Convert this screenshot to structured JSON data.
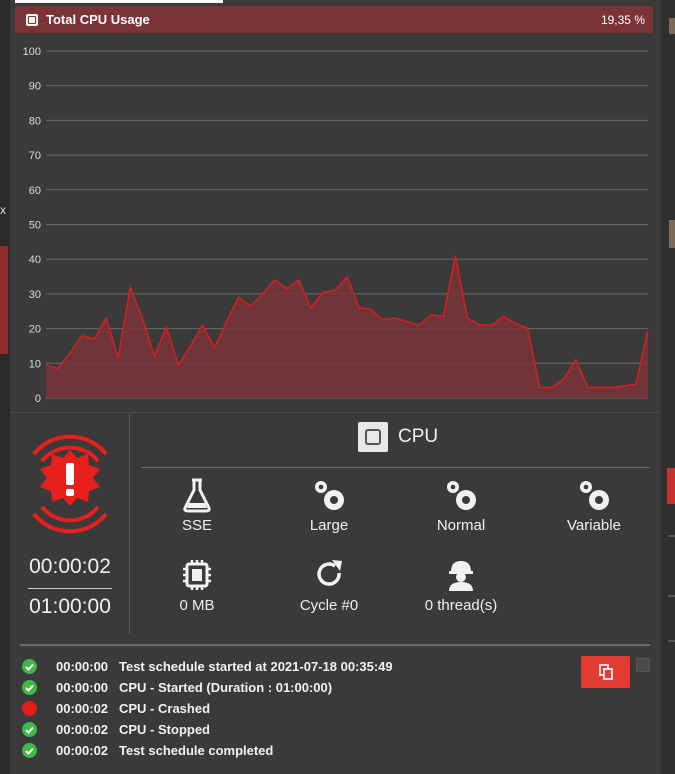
{
  "chart_header": {
    "title": "Total CPU Usage",
    "value": "19,35 %",
    "header_color": "#7a3337"
  },
  "chart_data": {
    "type": "area",
    "ylim": [
      0,
      100
    ],
    "y_ticks": [
      "100",
      "90",
      "80",
      "70",
      "60",
      "50",
      "40",
      "30",
      "20",
      "10",
      "0"
    ],
    "grid": true,
    "line_color": "#d02020",
    "fill_color": "#7a3337",
    "series": [
      {
        "values": [
          9.5,
          8.5,
          13,
          18,
          17,
          23,
          11.5,
          32,
          23,
          12,
          20.5,
          9.5,
          15,
          21,
          14.5,
          22,
          29,
          26.5,
          30,
          34,
          31.5,
          34,
          26,
          30.5,
          31,
          35,
          26,
          25.5,
          22.5,
          23,
          22,
          21,
          24,
          23.5,
          41,
          23,
          21,
          21,
          23.5,
          21.5,
          20,
          3,
          3,
          5.5,
          11,
          3,
          3,
          3,
          3.5,
          4,
          19.5
        ]
      }
    ]
  },
  "status": {
    "alarm_icon": "alarm-exclamation-icon",
    "elapsed": "00:00:02",
    "duration": "01:00:00"
  },
  "device": {
    "icon": "cpu-chip-icon",
    "name": "CPU"
  },
  "stats": [
    {
      "icon": "flask-icon",
      "label": "SSE"
    },
    {
      "icon": "gears-icon",
      "label": "Large"
    },
    {
      "icon": "gears-icon",
      "label": "Normal"
    },
    {
      "icon": "gears-icon",
      "label": "Variable"
    },
    {
      "icon": "memory-chip-icon",
      "label": "0 MB"
    },
    {
      "icon": "refresh-icon",
      "label": "Cycle #0"
    },
    {
      "icon": "worker-icon",
      "label": "0 thread(s)"
    }
  ],
  "log": [
    {
      "status": "ok",
      "time": "00:00:00",
      "message": "Test schedule started at 2021-07-18 00:35:49"
    },
    {
      "status": "ok",
      "time": "00:00:00",
      "message": "CPU - Started (Duration : 01:00:00)"
    },
    {
      "status": "error",
      "time": "00:00:02",
      "message": "CPU - Crashed"
    },
    {
      "status": "ok",
      "time": "00:00:02",
      "message": "CPU - Stopped"
    },
    {
      "status": "ok",
      "time": "00:00:02",
      "message": "Test schedule completed"
    }
  ],
  "colors": {
    "ok": "#3fb84a",
    "error": "#e21b1b",
    "alarm": "#e8201c",
    "copy_button": "#e13b32"
  },
  "left_strip": {
    "fragment": "x"
  }
}
